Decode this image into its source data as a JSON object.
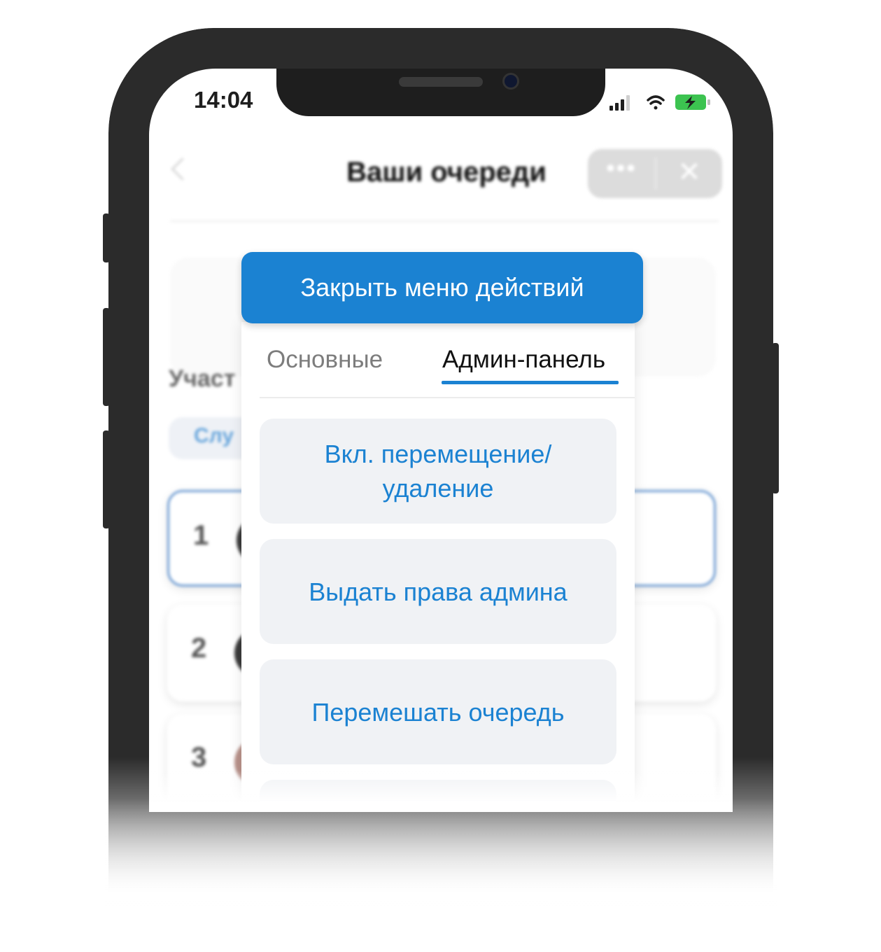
{
  "status_bar": {
    "time": "14:04"
  },
  "nav": {
    "title": "Ваши очереди",
    "more_icon": "more-dots-icon",
    "close_icon": "close-icon"
  },
  "background": {
    "participants_label": "Участ",
    "filter_chip": "Слу",
    "rows": [
      {
        "number": "1"
      },
      {
        "number": "2"
      },
      {
        "number": "3"
      }
    ]
  },
  "action_sheet": {
    "close_button": "Закрыть меню действий",
    "tabs": [
      {
        "label": "Основные",
        "active": false
      },
      {
        "label": "Админ-панель",
        "active": true
      }
    ],
    "actions": [
      {
        "label": "Вкл. перемещение/ удаление"
      },
      {
        "label": "Выдать права админа"
      },
      {
        "label": "Перемешать очередь"
      }
    ]
  },
  "colors": {
    "accent": "#1b82d2",
    "action_bg": "#f0f2f5",
    "battery": "#3cc350"
  }
}
